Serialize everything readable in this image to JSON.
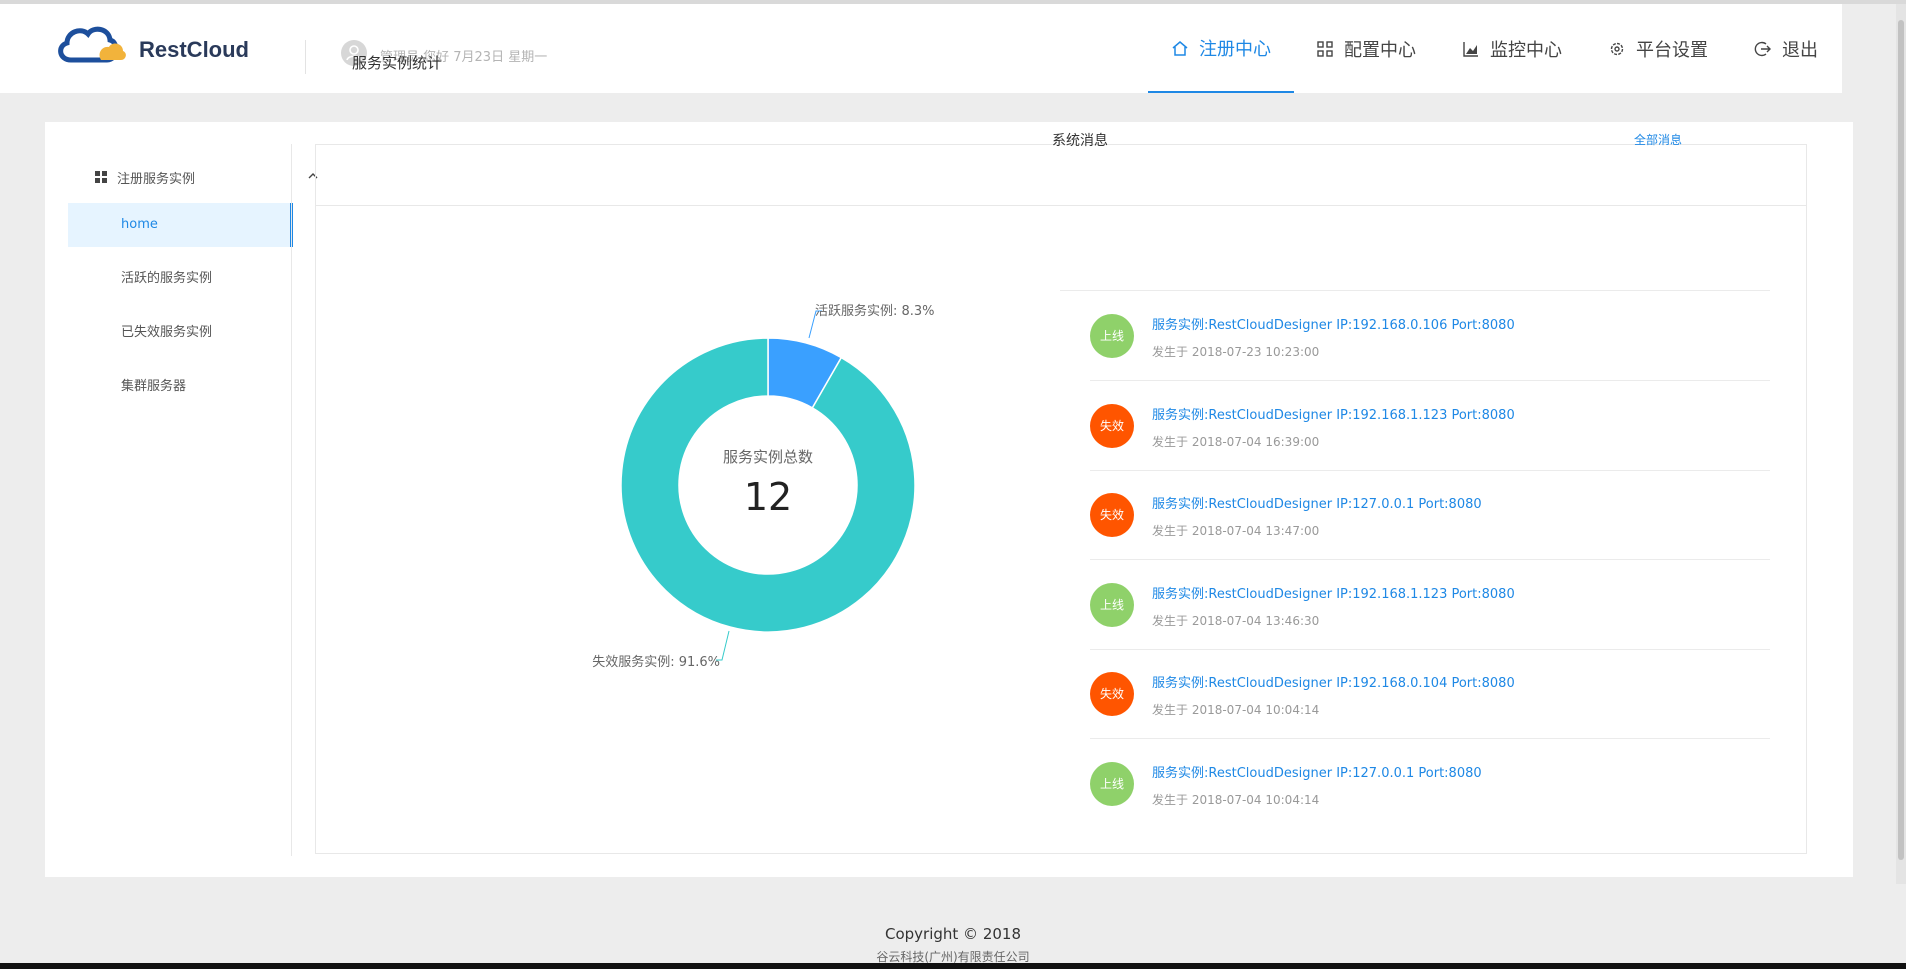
{
  "header": {
    "brand": "RestCloud",
    "greeting": "管理员 您好 7月23日 星期一",
    "nav": [
      {
        "label": "注册中心",
        "icon": "home-icon",
        "active": true
      },
      {
        "label": "配置中心",
        "icon": "grid-icon",
        "active": false
      },
      {
        "label": "监控中心",
        "icon": "chart-icon",
        "active": false
      },
      {
        "label": "平台设置",
        "icon": "gear-icon",
        "active": false
      },
      {
        "label": "退出",
        "icon": "logout-icon",
        "active": false
      }
    ]
  },
  "sidebar": {
    "group": "注册服务实例",
    "items": [
      "home",
      "活跃的服务实例",
      "已失效服务实例",
      "集群服务器"
    ]
  },
  "card": {
    "title": "服务实例统计",
    "donut": {
      "center_label": "服务实例总数",
      "total": "12",
      "active_label": "活跃服务实例: 8.3%",
      "failed_label": "失效服务实例: 91.6%"
    }
  },
  "chart_data": {
    "type": "pie",
    "categories": [
      "活跃服务实例",
      "失效服务实例"
    ],
    "values": [
      8.3,
      91.6
    ],
    "colors": [
      "#3aa0ff",
      "#36cbcb"
    ]
  },
  "messages": {
    "title": "系统消息",
    "all_link": "全部消息",
    "items": [
      {
        "badge": "上线",
        "color": "#8fd16a",
        "text": "服务实例:RestCloudDesigner IP:192.168.0.106 Port:8080",
        "time": "发生于 2018-07-23 10:23:00"
      },
      {
        "badge": "失效",
        "color": "#ff5500",
        "text": "服务实例:RestCloudDesigner IP:192.168.1.123 Port:8080",
        "time": "发生于 2018-07-04 16:39:00"
      },
      {
        "badge": "失效",
        "color": "#ff5500",
        "text": "服务实例:RestCloudDesigner IP:127.0.0.1 Port:8080",
        "time": "发生于 2018-07-04 13:47:00"
      },
      {
        "badge": "上线",
        "color": "#8fd16a",
        "text": "服务实例:RestCloudDesigner IP:192.168.1.123 Port:8080",
        "time": "发生于 2018-07-04 13:46:30"
      },
      {
        "badge": "失效",
        "color": "#ff5500",
        "text": "服务实例:RestCloudDesigner IP:192.168.0.104 Port:8080",
        "time": "发生于 2018-07-04 10:04:14"
      },
      {
        "badge": "上线",
        "color": "#8fd16a",
        "text": "服务实例:RestCloudDesigner IP:127.0.0.1 Port:8080",
        "time": "发生于 2018-07-04 10:04:14"
      }
    ]
  },
  "footer": {
    "copyright": "Copyright © 2018",
    "company": "谷云科技(广州)有限责任公司"
  }
}
